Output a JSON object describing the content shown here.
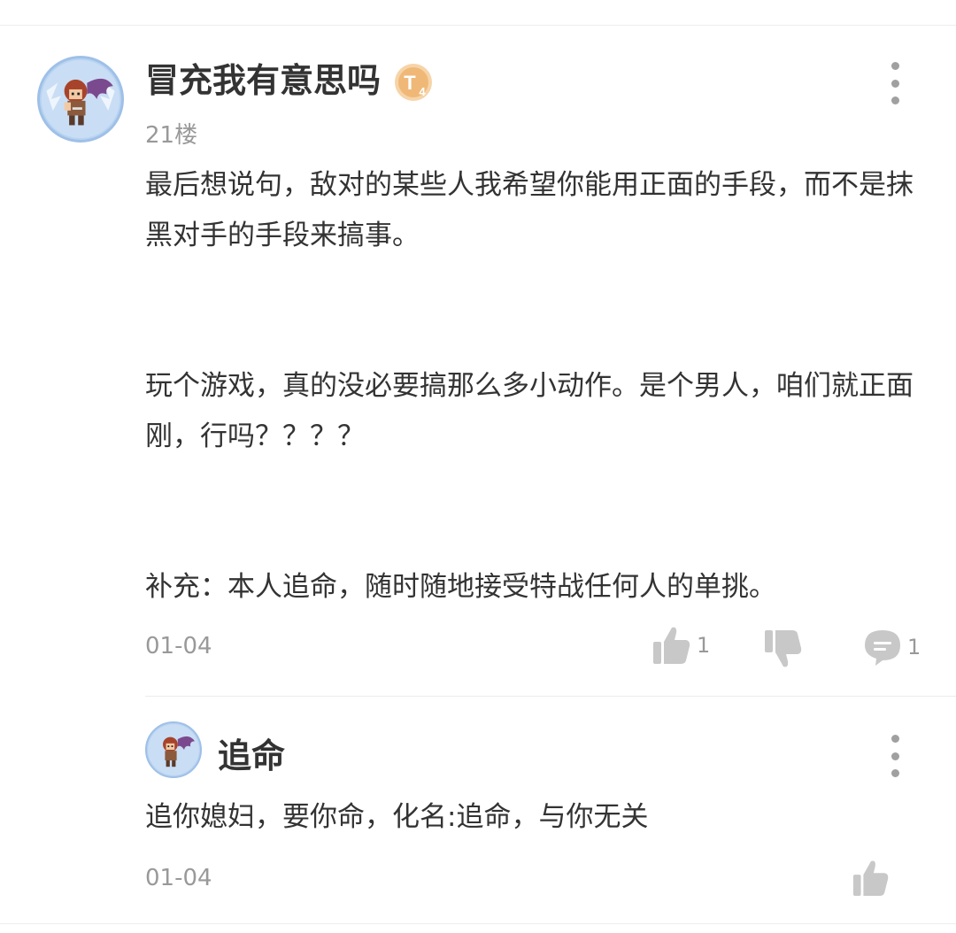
{
  "post": {
    "username": "冒充我有意思吗",
    "level_badge_icon": "level-badge-t4",
    "floor": "21楼",
    "paragraphs": [
      "最后想说句，敌对的某些人我希望你能用正面的手段，而不是抹黑对手的手段来搞事。",
      "玩个游戏，真的没必要搞那么多小动作。是个男人，咱们就正面刚，行吗？？？？",
      "补充：本人追命，随时随地接受特战任何人的单挑。"
    ],
    "date": "01-04",
    "like_count": "1",
    "reply_count": "1"
  },
  "reply": {
    "username": "追命",
    "content": "追你媳妇，要你命，化名:追命，与你无关",
    "date": "01-04"
  },
  "colors": {
    "text_primary": "#333333",
    "text_secondary": "#999999",
    "icon_gray": "#c8c8c8",
    "badge_gold": "#f3c48a"
  }
}
